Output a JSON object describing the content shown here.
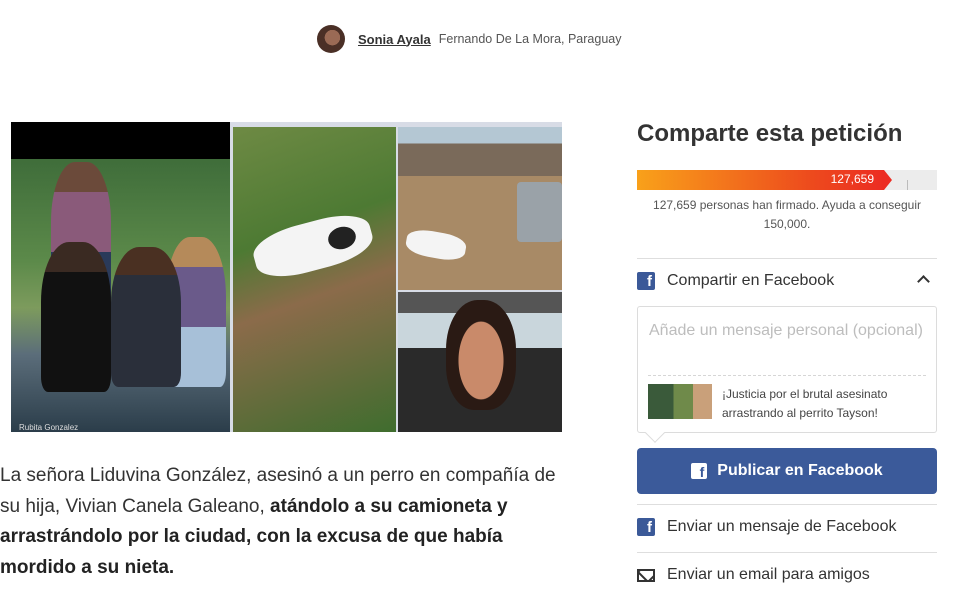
{
  "author": {
    "name": "Sonia Ayala",
    "location": "Fernando De La Mora, Paraguay"
  },
  "collage": {
    "credit": "Rubita Gonzalez"
  },
  "description": {
    "plain": "La señora Liduvina González, asesinó a un perro en compañía de su hija, Vivian Canela Galeano, ",
    "bold": "atándolo a su camioneta y arrastrándolo por la ciudad, con la excusa de que había mordido a su nieta."
  },
  "share": {
    "title": "Comparte esta petición",
    "signature_count": "127,659",
    "progress_fraction": 0.851,
    "signed_text": "127,659 personas han firmado. Ayuda a conseguir 150,000.",
    "facebook_share_label": "Compartir en Facebook",
    "message_placeholder": "Añade un mensaje personal (opcional)",
    "preview_text": "¡Justicia por el brutal asesinato arrastrando al perrito Tayson!",
    "publish_label": "Publicar en Facebook",
    "messenger_label": "Enviar un mensaje de Facebook",
    "email_label": "Enviar un email para amigos"
  },
  "icons": {
    "facebook": "facebook-icon",
    "chevron": "chevron-up-icon",
    "mail": "mail-icon"
  },
  "colors": {
    "facebook_blue": "#3b5a9a",
    "progress_start": "#f9a11a",
    "progress_end": "#ec2c22"
  }
}
